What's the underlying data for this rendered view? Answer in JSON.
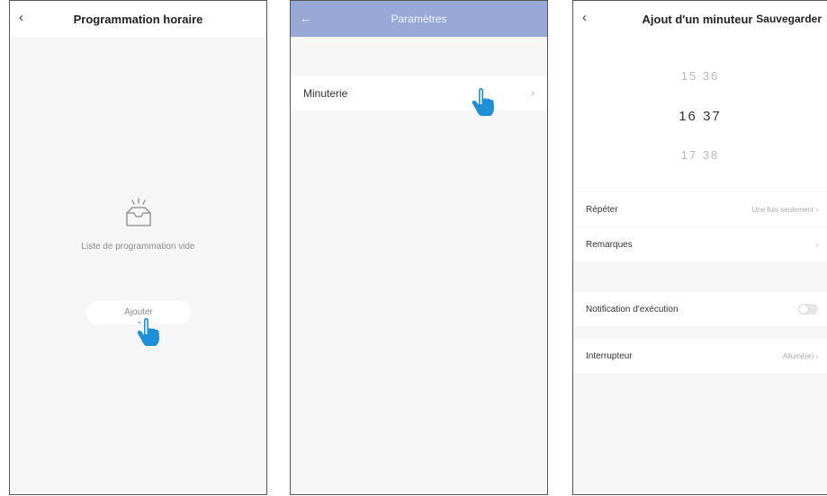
{
  "screen1": {
    "title": "Programmation horaire",
    "back_icon": "‹",
    "empty_text": "Liste de programmation vide",
    "add_button": "Ajouter"
  },
  "screen2": {
    "title": "Paramètres",
    "back_icon": "←",
    "row_label": "Minuterie",
    "chevron": "›"
  },
  "screen3": {
    "back_icon": "‹",
    "title": "Ajout d'un minuteur",
    "save": "Sauvegarder",
    "picker": {
      "prev": {
        "hour": "15",
        "minute": "36"
      },
      "selected": {
        "hour": "16",
        "minute": "37"
      },
      "next": {
        "hour": "17",
        "minute": "38"
      }
    },
    "rows": {
      "repeat": {
        "label": "Répéter",
        "value": "Une fois seulement ›"
      },
      "notes": {
        "label": "Remarques",
        "value": "›"
      },
      "notification": {
        "label": "Notification d'exécution",
        "toggle": false
      },
      "switch": {
        "label": "Interrupteur",
        "value": "Allumé(e) ›"
      }
    }
  },
  "colors": {
    "accent_header": "#98a9d7",
    "hand": "#1f8fd8"
  },
  "icons": [
    "back-chevron-icon",
    "back-arrow-icon",
    "empty-inbox-icon",
    "hand-pointer-icon",
    "chevron-right-icon",
    "toggle-switch"
  ]
}
